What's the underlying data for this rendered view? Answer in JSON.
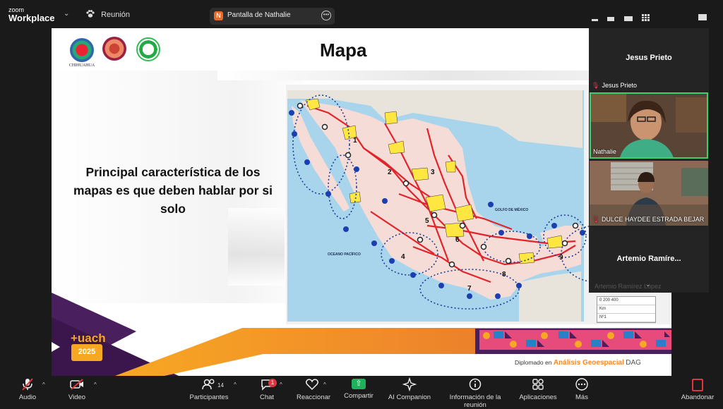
{
  "app": {
    "brand_small": "zoom",
    "brand_big": "Workplace",
    "meeting_label": "Reunión",
    "share_initial": "N",
    "share_label": "Pantalla de Nathalie"
  },
  "slide": {
    "title": "Mapa",
    "body_text": "Principal característica de los mapas es que deben hablar por si solo",
    "logo1_caption": "CHIHUAHUA",
    "uach_text": "+uach",
    "uach_year": "2025",
    "footer_prefix": "Diplomado en",
    "footer_program": "Análisis Geoespacial",
    "footer_suffix": "DAG",
    "map_labels": {
      "gulf": "GOLFO DE MÉXICO",
      "pacific": "OCEANO PACÍFICO",
      "regions": [
        "1",
        "2",
        "3",
        "4",
        "5",
        "6",
        "7",
        "8",
        "9"
      ]
    },
    "legend_rows": [
      "0   200   400",
      "Km",
      "Nº1"
    ]
  },
  "participants_panel": {
    "top_tile_name": "Jesus Prieto",
    "top_tile_tag": "Jesus Prieto",
    "video1_name": "Nathalie",
    "video2_name": "DULCE HAYDEE ESTRADA BEJAR",
    "bottom_tile_name": "Artemio  Ramíre...",
    "ghost_name": "Artemio Ramírez López"
  },
  "toolbar": {
    "audio": "Audio",
    "video": "Video",
    "participants": "Participantes",
    "participants_count": "14",
    "chat": "Chat",
    "chat_badge": "1",
    "reactions": "Reaccionar",
    "share": "Compartir",
    "ai": "AI Companion",
    "info": "Información de la reunión",
    "apps": "Aplicaciones",
    "more": "Más",
    "leave": "Abandonar"
  },
  "colors": {
    "share_green": "#1fb25a",
    "active_speaker_border": "#3ccf6e",
    "mute_red": "#e0353e",
    "slide_purple": "#4a1f5e",
    "slide_orange": "#f08a2a"
  }
}
